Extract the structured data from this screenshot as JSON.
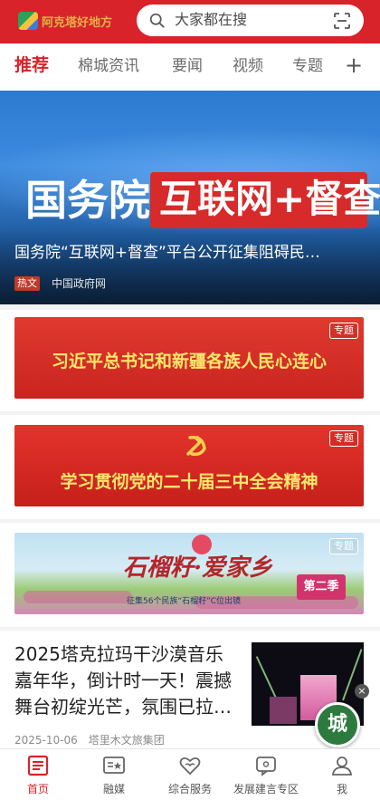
{
  "header": {
    "logo_text": "阿克塔好地方",
    "search_placeholder": "大家都在搜"
  },
  "tabs": [
    {
      "label": "推荐",
      "active": true
    },
    {
      "label": "棉城资讯",
      "active": false
    },
    {
      "label": "要闻",
      "active": false
    },
    {
      "label": "视频",
      "active": false
    },
    {
      "label": "专题",
      "active": false
    }
  ],
  "tab_add_label": "+",
  "hero": {
    "image_text_1": "国务院",
    "image_text_2": "互联网+督查",
    "title": "国务院“互联网+督查”平台公开征集阻碍民…",
    "badge": "热文",
    "source": "中国政府网"
  },
  "banners": [
    {
      "text": "习近平总书记和新疆各族人民心连心",
      "tag": "专题"
    },
    {
      "text": "学习贯彻党的二十届三中全会精神",
      "tag": "专题"
    },
    {
      "title": "石榴籽·爱家乡",
      "badge": "第二季",
      "subtitle": "征集56个民族“石榴籽”C位出镜",
      "tag": "专题"
    }
  ],
  "article": {
    "title": "2025塔克拉玛干沙漠音乐嘉年华，倒计时一天！震撼舞台初绽光芒，氛围已拉…",
    "date": "2025-10-06",
    "source": "塔里木文旅集团",
    "close_label": "×",
    "float_label": "城"
  },
  "bottom_nav": [
    {
      "label": "首页",
      "icon": "home-news-icon",
      "active": true
    },
    {
      "label": "融媒",
      "icon": "media-icon",
      "active": false
    },
    {
      "label": "综合服务",
      "icon": "heart-service-icon",
      "active": false
    },
    {
      "label": "发展建言专区",
      "icon": "suggestion-icon",
      "active": false
    },
    {
      "label": "我",
      "icon": "user-icon",
      "active": false
    }
  ],
  "colors": {
    "brand_red": "#d8232a",
    "banner_text": "#ffe76a"
  }
}
